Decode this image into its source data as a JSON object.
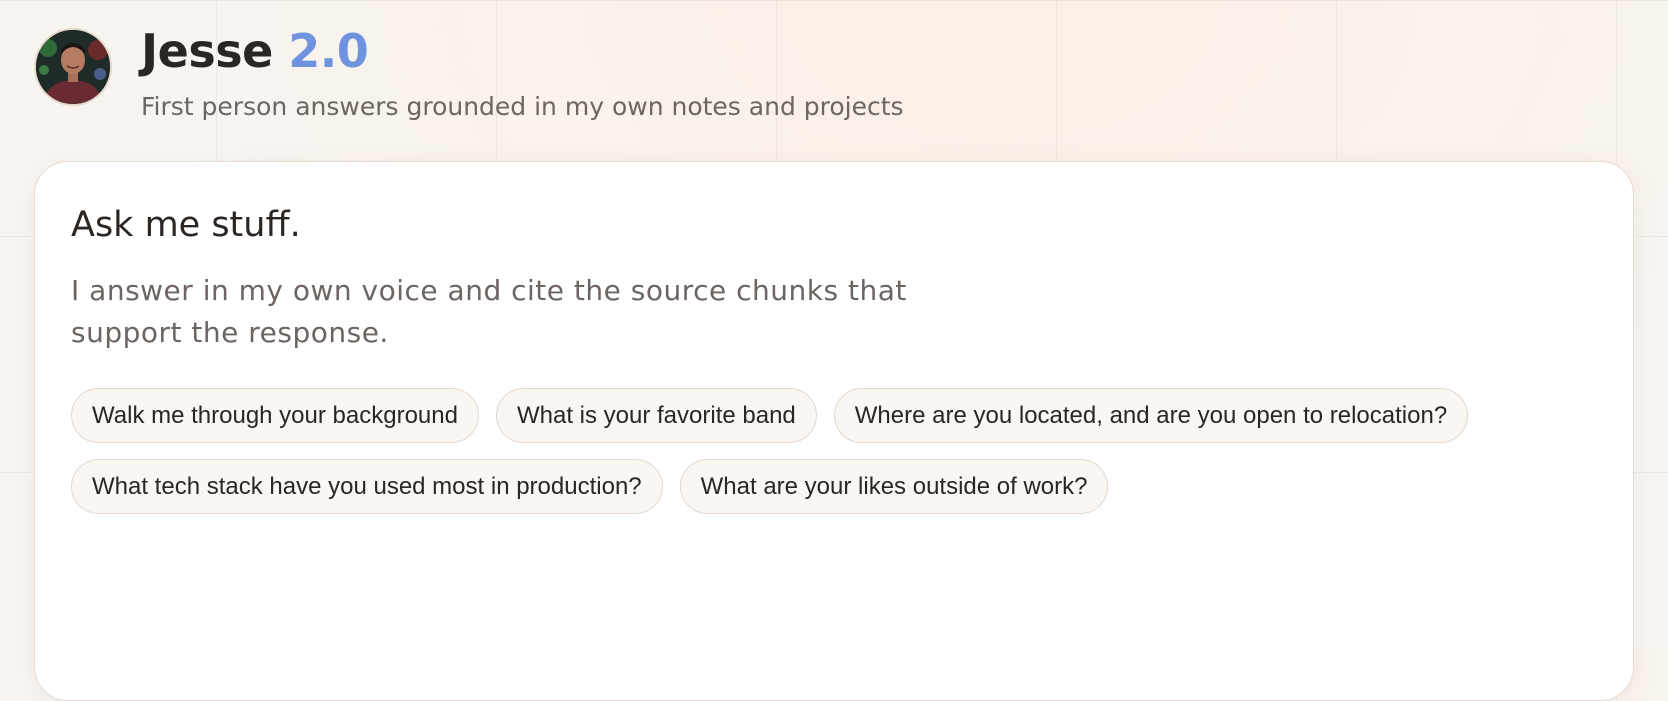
{
  "header": {
    "name": "Jesse",
    "version": "2.0",
    "tagline": "First person answers grounded in my own notes and projects"
  },
  "card": {
    "title": "Ask me stuff.",
    "description": "I answer in my own voice and cite the source chunks that support the response."
  },
  "suggestions": [
    "Walk me through your background",
    "What is your favorite band",
    "Where are you located, and are you open to relocation?",
    "What tech stack have you used most in production?",
    "What are your likes outside of work?"
  ],
  "colors": {
    "accent": "#6e93df",
    "text": "#2c2623",
    "muted": "#6c6562",
    "background": "#f8f4f0"
  }
}
